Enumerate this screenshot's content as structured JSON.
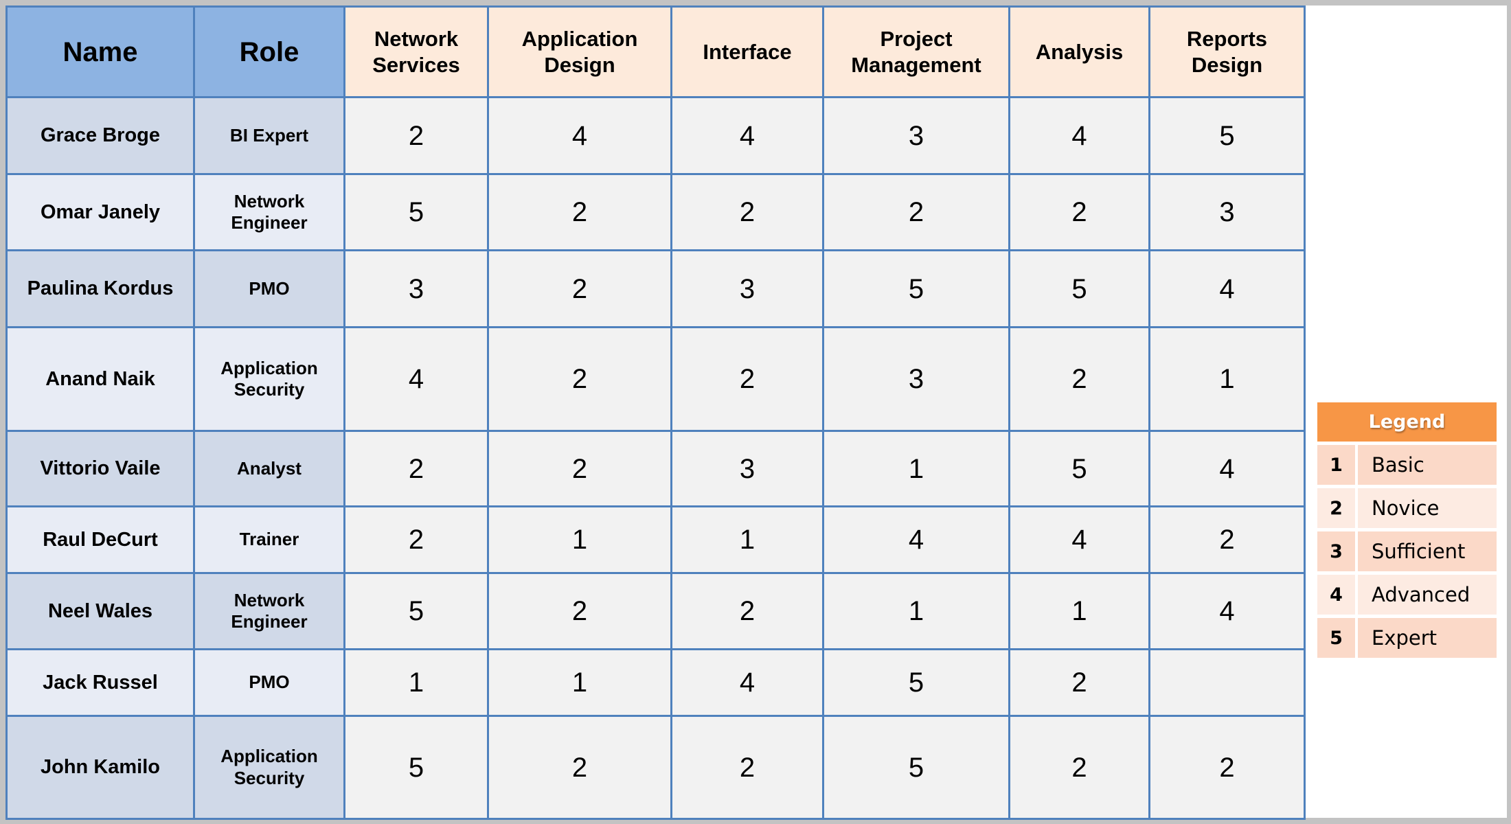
{
  "table": {
    "headers": {
      "name": "Name",
      "role": "Role",
      "skills": [
        "Network Services",
        "Application Design",
        "Interface",
        "Project Management",
        "Analysis",
        "Reports Design"
      ]
    },
    "rows": [
      {
        "name": "Grace Broge",
        "role": "BI Expert",
        "scores": [
          "2",
          "4",
          "4",
          "3",
          "4",
          "5"
        ]
      },
      {
        "name": "Omar Janely",
        "role": "Network Engineer",
        "scores": [
          "5",
          "2",
          "2",
          "2",
          "2",
          "3"
        ]
      },
      {
        "name": "Paulina Kordus",
        "role": "PMO",
        "scores": [
          "3",
          "2",
          "3",
          "5",
          "5",
          "4"
        ]
      },
      {
        "name": "Anand Naik",
        "role": "Application Security",
        "scores": [
          "4",
          "2",
          "2",
          "3",
          "2",
          "1"
        ]
      },
      {
        "name": "Vittorio Vaile",
        "role": "Analyst",
        "scores": [
          "2",
          "2",
          "3",
          "1",
          "5",
          "4"
        ]
      },
      {
        "name": "Raul DeCurt",
        "role": "Trainer",
        "scores": [
          "2",
          "1",
          "1",
          "4",
          "4",
          "2"
        ]
      },
      {
        "name": "Neel Wales",
        "role": "Network Engineer",
        "scores": [
          "5",
          "2",
          "2",
          "1",
          "1",
          "4"
        ]
      },
      {
        "name": "Jack Russel",
        "role": "PMO",
        "scores": [
          "1",
          "1",
          "4",
          "5",
          "2",
          ""
        ]
      },
      {
        "name": "John Kamilo",
        "role": "Application Security",
        "scores": [
          "5",
          "2",
          "2",
          "5",
          "2",
          "2"
        ]
      }
    ]
  },
  "legend": {
    "title": "Legend",
    "items": [
      {
        "level": "1",
        "label": "Basic"
      },
      {
        "level": "2",
        "label": "Novice"
      },
      {
        "level": "3",
        "label": "Sufficient"
      },
      {
        "level": "4",
        "label": "Advanced"
      },
      {
        "level": "5",
        "label": "Expert"
      }
    ]
  },
  "colors": {
    "key_header": "#8db3e2",
    "skill_header": "#fdeadb",
    "grid_border": "#4f81bd",
    "legend_header": "#f79646"
  }
}
